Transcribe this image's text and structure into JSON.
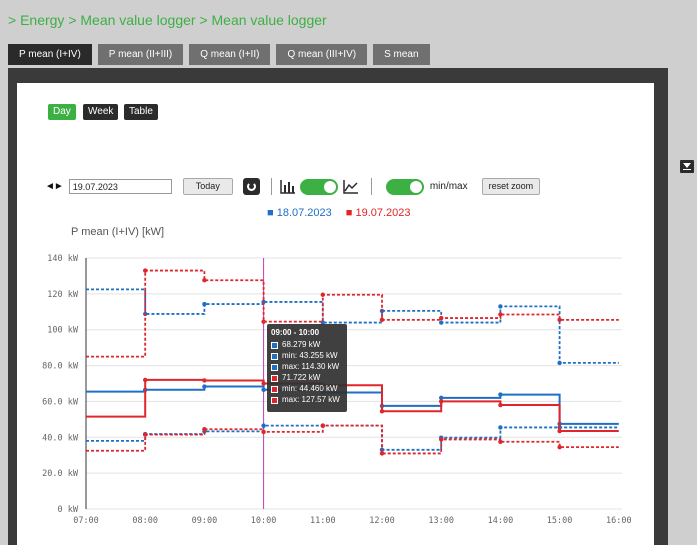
{
  "breadcrumb": "> Energy > Mean value logger > Mean value logger",
  "tabs": [
    "P mean (I+IV)",
    "P mean (II+III)",
    "Q mean (I+II)",
    "Q mean (III+IV)",
    "S mean"
  ],
  "active_tab": 0,
  "view_buttons": {
    "day": "Day",
    "week": "Week",
    "table": "Table"
  },
  "controls": {
    "arrows": "◄►",
    "date_value": "19.07.2023",
    "today": "Today",
    "minmax": "min/max",
    "reset_zoom": "reset zoom"
  },
  "legend": {
    "day1": "18.07.2023",
    "day2": "19.07.2023"
  },
  "colors": {
    "blue": "#1f6fc5",
    "red": "#e0262a",
    "accent": "#3cb043"
  },
  "icons": [
    "download-icon",
    "refresh-icon",
    "bar-chart-icon",
    "line-chart-icon"
  ],
  "tooltip": {
    "title": "09:00 - 10:00",
    "rows": [
      "68.279 kW",
      "min: 43.255 kW",
      "max: 114.30 kW",
      "71.722 kW",
      "min: 44.460 kW",
      "max: 127.57 kW"
    ]
  },
  "chart_data": {
    "type": "line",
    "title": "P mean (I+IV) [kW]",
    "x": [
      "07:00",
      "08:00",
      "09:00",
      "10:00",
      "11:00",
      "12:00",
      "13:00",
      "14:00",
      "15:00",
      "16:00"
    ],
    "y_ticks": [
      "0 kW",
      "20.0 kW",
      "40.0 kW",
      "60.0 kW",
      "80.0 kW",
      "100 kW",
      "120 kW",
      "140 kW"
    ],
    "ylim": [
      0,
      140
    ],
    "step": true,
    "series": [
      {
        "name": "18.07.2023",
        "color": "#1f6fc5",
        "style": "solid",
        "values": [
          65.5,
          66.5,
          68.3,
          66.5,
          65.0,
          57.5,
          62.0,
          63.8,
          47.5
        ]
      },
      {
        "name": "18.07.2023 max",
        "color": "#1f6fc5",
        "style": "dashed",
        "values": [
          122.5,
          108.8,
          114.3,
          115.5,
          104.0,
          110.5,
          104.0,
          113.0,
          81.5
        ]
      },
      {
        "name": "18.07.2023 min",
        "color": "#1f6fc5",
        "style": "dashed",
        "values": [
          38.0,
          41.8,
          43.3,
          46.5,
          46.5,
          33.0,
          39.8,
          45.5,
          45.5
        ]
      },
      {
        "name": "19.07.2023",
        "color": "#e0262a",
        "style": "solid",
        "values": [
          51.5,
          72.0,
          71.7,
          70.0,
          69.0,
          54.5,
          60.0,
          58.0,
          43.5
        ]
      },
      {
        "name": "19.07.2023 max",
        "color": "#e0262a",
        "style": "dashed",
        "values": [
          85.0,
          133.0,
          127.6,
          104.5,
          119.5,
          105.5,
          106.5,
          108.5,
          105.5
        ]
      },
      {
        "name": "19.07.2023 min",
        "color": "#e0262a",
        "style": "dashed",
        "values": [
          32.5,
          41.5,
          44.5,
          43.0,
          46.5,
          31.0,
          38.8,
          37.5,
          34.5
        ]
      }
    ],
    "highlight_x": "10:00",
    "grid": true
  }
}
